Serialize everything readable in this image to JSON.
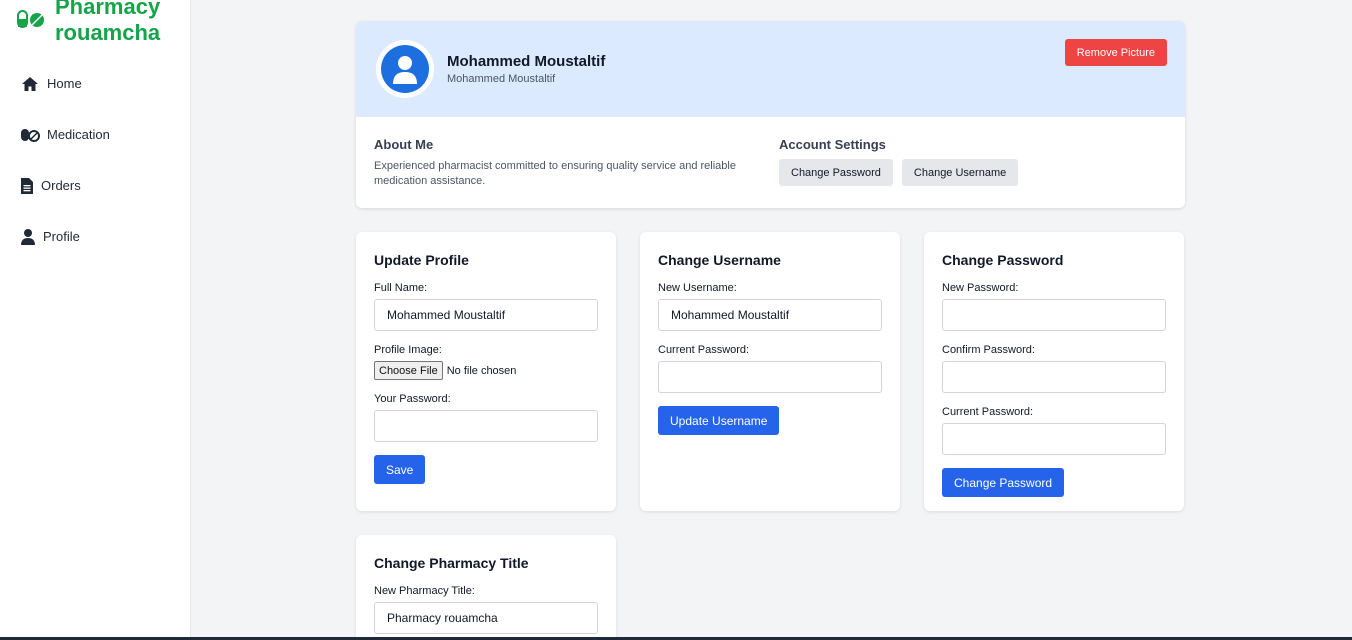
{
  "brand": {
    "name_line1": "Pharmacy",
    "name_line2": "rouamcha",
    "color": "#16a34a"
  },
  "sidebar": {
    "items": [
      {
        "label": "Home",
        "icon": "home-icon"
      },
      {
        "label": "Medication",
        "icon": "pills-icon"
      },
      {
        "label": "Orders",
        "icon": "document-icon"
      },
      {
        "label": "Profile",
        "icon": "user-icon"
      }
    ]
  },
  "profile": {
    "name": "Mohammed Moustaltif",
    "subtitle": "Mohammed Moustaltif",
    "remove_picture_label": "Remove Picture",
    "about_title": "About Me",
    "about_text": "Experienced pharmacist committed to ensuring quality service and reliable medication assistance.",
    "account_settings_title": "Account Settings",
    "change_password_label": "Change Password",
    "change_username_label": "Change Username"
  },
  "update_profile": {
    "title": "Update Profile",
    "full_name_label": "Full Name:",
    "full_name_value": "Mohammed Moustaltif",
    "profile_image_label": "Profile Image:",
    "choose_file_label": "Choose File",
    "no_file_text": "No file chosen",
    "password_label": "Your Password:",
    "save_label": "Save"
  },
  "change_username": {
    "title": "Change Username",
    "new_username_label": "New Username:",
    "new_username_value": "Mohammed Moustaltif",
    "current_password_label": "Current Password:",
    "submit_label": "Update Username"
  },
  "change_password": {
    "title": "Change Password",
    "new_password_label": "New Password:",
    "confirm_password_label": "Confirm Password:",
    "current_password_label": "Current Password:",
    "submit_label": "Change Password"
  },
  "change_title": {
    "title": "Change Pharmacy Title",
    "new_title_label": "New Pharmacy Title:",
    "new_title_value": "Pharmacy rouamcha"
  },
  "colors": {
    "accent": "#2563eb",
    "danger": "#ef4444",
    "header_bg": "#dbeafe"
  }
}
